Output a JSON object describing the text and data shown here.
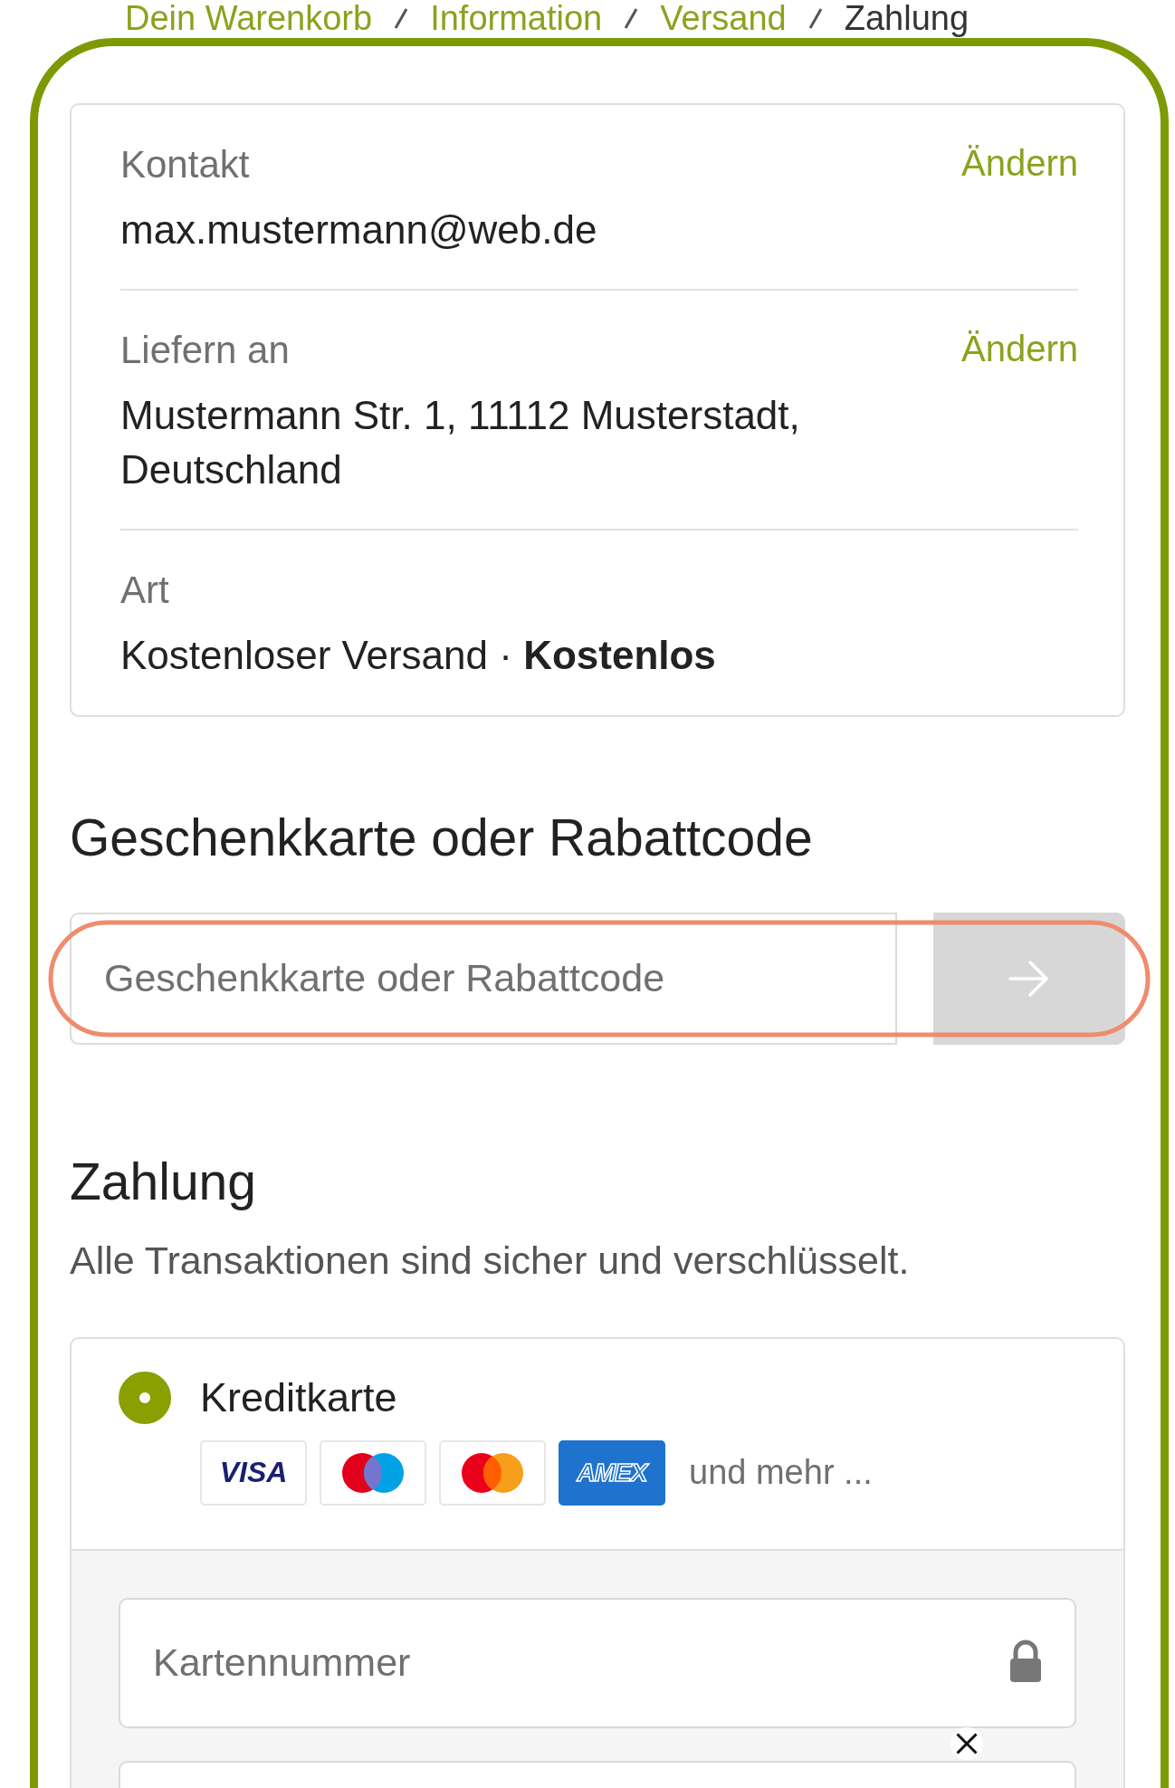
{
  "breadcrumb": [
    {
      "label": "Dein Warenkorb",
      "selected": false
    },
    {
      "label": "Information",
      "selected": false
    },
    {
      "label": "Versand",
      "selected": false
    },
    {
      "label": "Zahlung",
      "selected": true
    }
  ],
  "summary": [
    {
      "label": "Kontakt",
      "value": "max.mustermann@web.de",
      "action": "Ändern"
    },
    {
      "label": "Liefern an",
      "value": "Mustermann Str. 1, 11112 Musterstadt, Deutschland",
      "action": "Ändern"
    },
    {
      "label": "Art",
      "value": "Kostenloser Versand · **Kostenlos**"
    }
  ],
  "discount": {
    "title": "Geschenkkarte oder Rabattcode",
    "placeholder": "Geschenkkarte oder Rabattcode",
    "disabled": true
  },
  "payment": {
    "title": "Zahlung",
    "subtitle": "Alle Transaktionen sind sicher und verschlüsselt.",
    "methods": [
      {
        "label": "Kreditkarte",
        "selected": true,
        "logos": [
          {
            "kind": "visa",
            "label": "VISA"
          },
          {
            "kind": "maestro"
          },
          {
            "kind": "mastercard"
          },
          {
            "kind": "amex",
            "label": "AMEX"
          }
        ],
        "more": "und mehr ...",
        "fields": [
          {
            "placeholder": "Kartennummer",
            "locked": true
          }
        ]
      }
    ]
  }
}
